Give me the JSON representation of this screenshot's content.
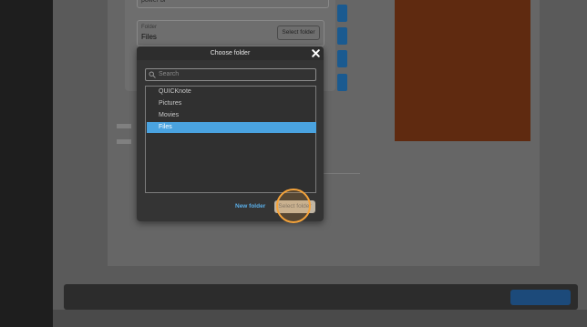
{
  "parent_form": {
    "title_value": "power bi",
    "folder_field": {
      "label": "Folder",
      "value": "Files",
      "select_button": "Select folder"
    }
  },
  "dialog": {
    "title": "Choose folder",
    "search_placeholder": "Search",
    "folders": [
      {
        "name": "QUICKnote",
        "selected": false
      },
      {
        "name": "Pictures",
        "selected": false
      },
      {
        "name": "Movies",
        "selected": false
      },
      {
        "name": "Files",
        "selected": true
      }
    ],
    "new_folder_label": "New folder",
    "select_folder_label": "Select folder"
  },
  "colors": {
    "accent_blue": "#4aa3e0",
    "click_highlight": "#f5a33a",
    "dialog_bg": "#343434"
  },
  "icons": [
    "close-icon",
    "search-icon"
  ]
}
